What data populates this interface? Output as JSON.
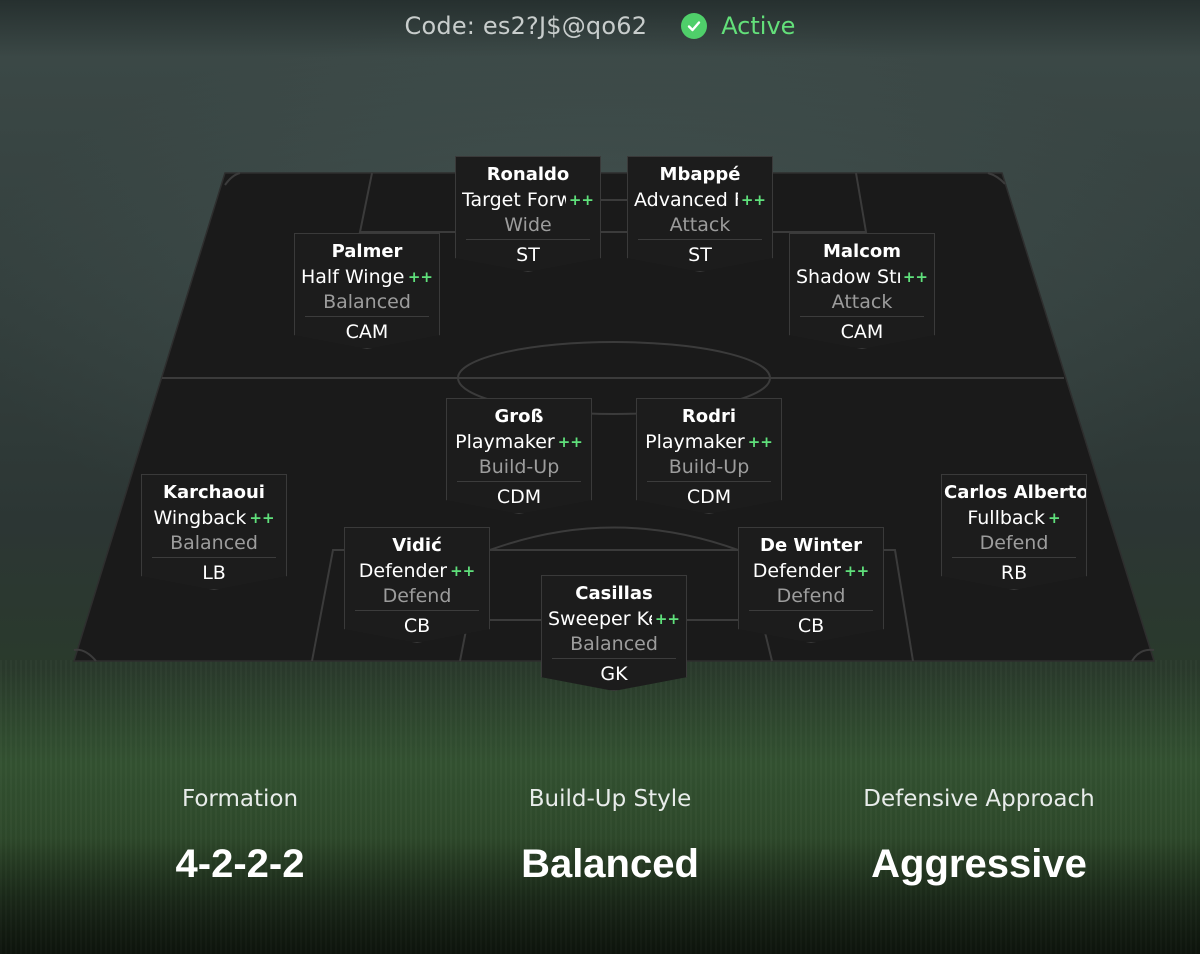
{
  "header": {
    "code_text": "Code: es2?J$@qo62",
    "status_text": "Active",
    "status_color": "#4fcf6a",
    "status_icon": "check-circle-icon"
  },
  "players": [
    {
      "name": "Ronaldo",
      "role": "Target Forward",
      "plus": "++",
      "focus": "Wide",
      "position": "ST"
    },
    {
      "name": "Mbappé",
      "role": "Advanced Forward",
      "plus": "++",
      "focus": "Attack",
      "position": "ST"
    },
    {
      "name": "Palmer",
      "role": "Half Winger",
      "plus": "++",
      "focus": "Balanced",
      "position": "CAM"
    },
    {
      "name": "Malcom",
      "role": "Shadow Striker",
      "plus": "++",
      "focus": "Attack",
      "position": "CAM"
    },
    {
      "name": "Groß",
      "role": "Playmaker",
      "plus": "++",
      "focus": "Build-Up",
      "position": "CDM"
    },
    {
      "name": "Rodri",
      "role": "Playmaker",
      "plus": "++",
      "focus": "Build-Up",
      "position": "CDM"
    },
    {
      "name": "Karchaoui",
      "role": "Wingback",
      "plus": "++",
      "focus": "Balanced",
      "position": "LB"
    },
    {
      "name": "Carlos Alberto",
      "role": "Fullback",
      "plus": "+",
      "focus": "Defend",
      "position": "RB"
    },
    {
      "name": "Vidić",
      "role": "Defender",
      "plus": "++",
      "focus": "Defend",
      "position": "CB"
    },
    {
      "name": "De Winter",
      "role": "Defender",
      "plus": "++",
      "focus": "Defend",
      "position": "CB"
    },
    {
      "name": "Casillas",
      "role": "Sweeper Keeper",
      "plus": "++",
      "focus": "Balanced",
      "position": "GK"
    }
  ],
  "summary": {
    "formation_label": "Formation",
    "formation_value": "4-2-2-2",
    "buildup_label": "Build-Up Style",
    "buildup_value": "Balanced",
    "defense_label": "Defensive Approach",
    "defense_value": "Aggressive"
  }
}
